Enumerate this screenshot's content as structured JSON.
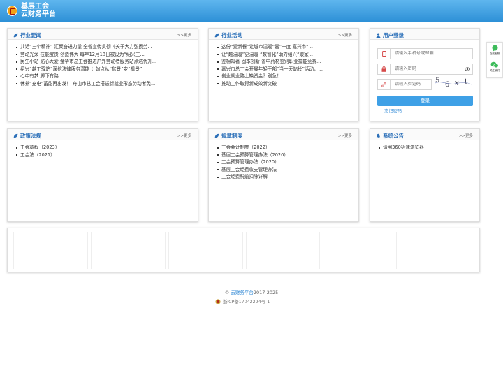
{
  "header": {
    "line1": "基层工会",
    "line2": "云财务平台"
  },
  "panels": {
    "industry_news": {
      "title": "行业要闻",
      "more": ">>更多",
      "items": [
        "共话“三个精神” 汇聚奋进力量 全省宣传贯彻《关于大力弘扬劳...",
        "劳动光荣 技能宝贵 创造伟大 每年12月18日被设为“绍兴工...",
        "民生小站 贴心大爱 金华市总工会推进户外劳动者服务站点迭代升...",
        "绍兴“越工驿站”深挖法律服务潜能 让站点从“盆景”变“枫景”",
        "心中有梦 脚下有路",
        "休养“充电”蓄能再出发！ 舟山市总工会搭送新就业形态劳动者免..."
      ]
    },
    "industry_activity": {
      "title": "行业活动",
      "more": ">>更多",
      "items": [
        "这份“爱新餐”让城市温暖“嘉”一度 嘉兴市“...",
        "让“越温暖”更温暖 “数智化”助力绍兴“娘家...",
        "鉴棉知著 固本创新 省中药材鉴别职业技能竞赛...",
        "嘉兴市总工会开展年轻干部“当一天站长”活动，...",
        "创业就业路上缺资金？别急！",
        "推动工作取得新成效新突破"
      ]
    },
    "login": {
      "title": "用户登录",
      "phone_placeholder": "请输入手机号或邮箱",
      "password_placeholder": "请输入密码",
      "captcha_placeholder": "请输入验证码",
      "captcha_text": "5 6 x t",
      "login_label": "登录",
      "forgot_label": "忘记密码"
    },
    "policy": {
      "title": "政策法规",
      "more": ">>更多",
      "items": [
        "工会章程（2023）",
        "工会法（2021）"
      ]
    },
    "rules": {
      "title": "规章制度",
      "more": ">>更多",
      "items": [
        "工会会计制度（2022）",
        "基层工会预算管理办法（2020）",
        "工会预算管理办法（2020）",
        "基层工会经费收支管理办法",
        "工会经费税前扣除详解"
      ]
    },
    "notice": {
      "title": "系统公告",
      "more": ">>更多",
      "items": [
        "请用360极速浏览器"
      ]
    }
  },
  "footer": {
    "copy_prefix": "©",
    "copy_link": "云财务平台",
    "copy_years": "2017-2025",
    "icp": "浙ICP备17042294号-1"
  },
  "side_float": {
    "item1": "在线客服",
    "item2": "关注我们"
  },
  "colors": {
    "header": "#2c8fd6",
    "accent": "#2b6fb8",
    "button": "#3ea0e6"
  }
}
